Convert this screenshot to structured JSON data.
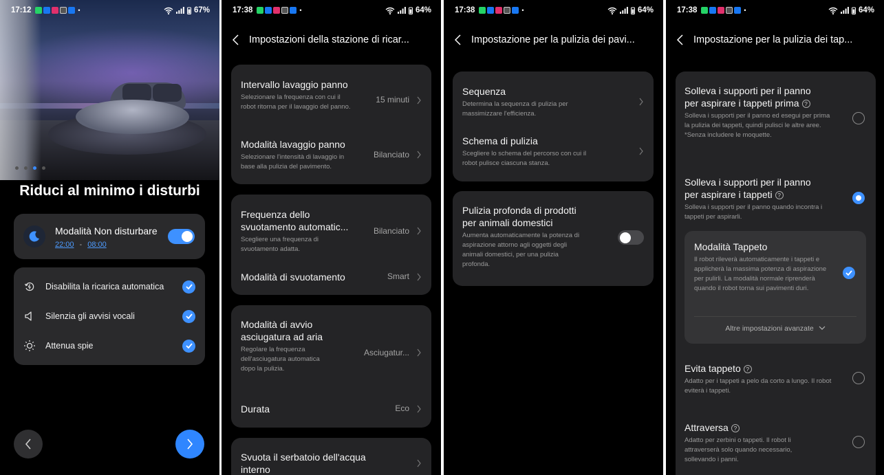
{
  "colors": {
    "accent": "#3e91ff",
    "background": "#000000",
    "card": "#242426",
    "card_light": "#2a2a2c",
    "subtext": "#9a9a9a"
  },
  "screen1": {
    "status": {
      "time": "17:12",
      "battery": "67%"
    },
    "title": "Riduci al minimo i disturbi",
    "dnd": {
      "label": "Modalità Non disturbare",
      "start": "22:00",
      "separator": "-",
      "end": "08:00",
      "enabled": true
    },
    "options": [
      {
        "icon": "charging-cycle-icon",
        "label": "Disabilita la ricarica automatica",
        "checked": true
      },
      {
        "icon": "speaker-icon",
        "label": "Silenzia gli avvisi vocali",
        "checked": true
      },
      {
        "icon": "brightness-icon",
        "label": "Attenua spie",
        "checked": true
      }
    ],
    "pager": {
      "count": 4,
      "active": 3
    }
  },
  "screen2": {
    "status": {
      "time": "17:38",
      "battery": "64%"
    },
    "header_title": "Impostazioni della stazione di ricar...",
    "groups": [
      [
        {
          "title": "Intervallo lavaggio panno",
          "desc": "Selezionare la frequenza con cui il robot ritorna per il lavaggio del panno.",
          "value": "15 minuti"
        },
        {
          "title": "Modalità lavaggio panno",
          "desc": "Selezionare l'intensità di lavaggio in base alla pulizia del pavimento.",
          "value": "Bilanciato"
        }
      ],
      [
        {
          "title": "Frequenza dello svuotamento automatic...",
          "desc": "Scegliere una frequenza di svuotamento adatta.",
          "value": "Bilanciato"
        },
        {
          "title": "Modalità di svuotamento",
          "desc": "",
          "value": "Smart"
        }
      ],
      [
        {
          "title": "Modalità di avvio asciugatura ad aria",
          "desc": "Regolare la frequenza dell'asciugatura automatica dopo la pulizia.",
          "value": "Asciugatur..."
        },
        {
          "title": "Durata",
          "desc": "",
          "value": "Eco"
        }
      ],
      [
        {
          "title": "Svuota il serbatoio dell'acqua interno",
          "desc": "",
          "value": ""
        }
      ]
    ]
  },
  "screen3": {
    "status": {
      "time": "17:38",
      "battery": "64%"
    },
    "header_title": "Impostazione per la pulizia dei pavi...",
    "items": [
      {
        "title": "Sequenza",
        "desc": "Determina la sequenza di pulizia per massimizzare l'efficienza."
      },
      {
        "title": "Schema di pulizia",
        "desc": "Scegliere lo schema del percorso con cui il robot pulisce ciascuna stanza."
      }
    ],
    "pet": {
      "title": "Pulizia profonda di prodotti per animali domestici",
      "desc": "Aumenta automaticamente la potenza di aspirazione attorno agli oggetti degli animali domestici, per una pulizia profonda.",
      "enabled": false
    }
  },
  "screen4": {
    "status": {
      "time": "17:38",
      "battery": "64%"
    },
    "header_title": "Impostazione per la pulizia dei tap...",
    "options": [
      {
        "title": "Solleva i supporti per il panno per aspirare i tappeti prima",
        "desc": "Solleva i supporti per il panno ed esegui per prima la pulizia dei tappeti, quindi pulisci le altre aree.\n*Senza includere le moquette.",
        "selected": false
      },
      {
        "title": "Solleva i supporti per il panno per aspirare i tappeti",
        "desc": "Solleva i supporti per il panno quando incontra i tappeti per aspirarli.",
        "selected": true
      },
      {
        "title": "Evita tappeto",
        "desc": "Adatto per i tappeti a pelo da corto a lungo. Il robot eviterà i tappeti.",
        "selected": false
      },
      {
        "title": "Attraversa",
        "desc": "Adatto per zerbini o tappeti. Il robot li attraverserà solo quando necessario, sollevando i panni.",
        "selected": false
      }
    ],
    "carpet_mode": {
      "title": "Modalità Tappeto",
      "desc": "Il robot rileverà automaticamente i tappeti e applicherà la massima potenza di aspirazione per pulirli. La modalità normale riprenderà quando il robot torna sui pavimenti duri.",
      "checked": true,
      "advanced": "Altre impostazioni avanzate"
    }
  }
}
